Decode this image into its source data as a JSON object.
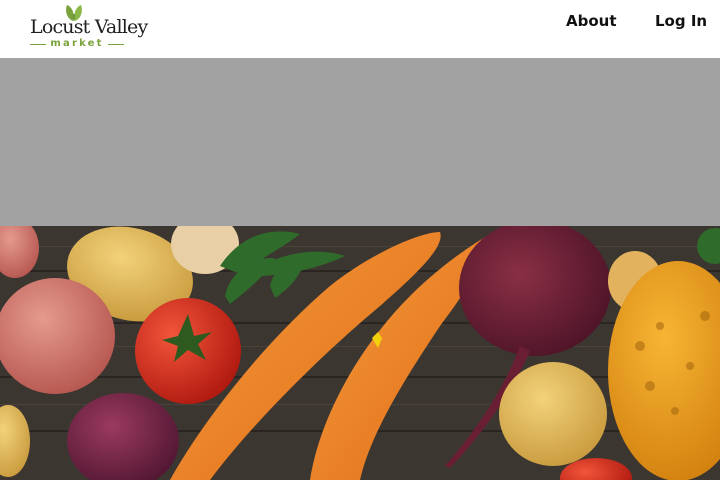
{
  "brand": {
    "name": "Locust Valley",
    "tagline": "market",
    "accent_color": "#7aa33b"
  },
  "nav": {
    "about_label": "About",
    "login_label": "Log In"
  },
  "banner": {
    "color": "#a2a2a2"
  },
  "hero": {
    "subject": "fresh vegetables on a wooden table"
  }
}
